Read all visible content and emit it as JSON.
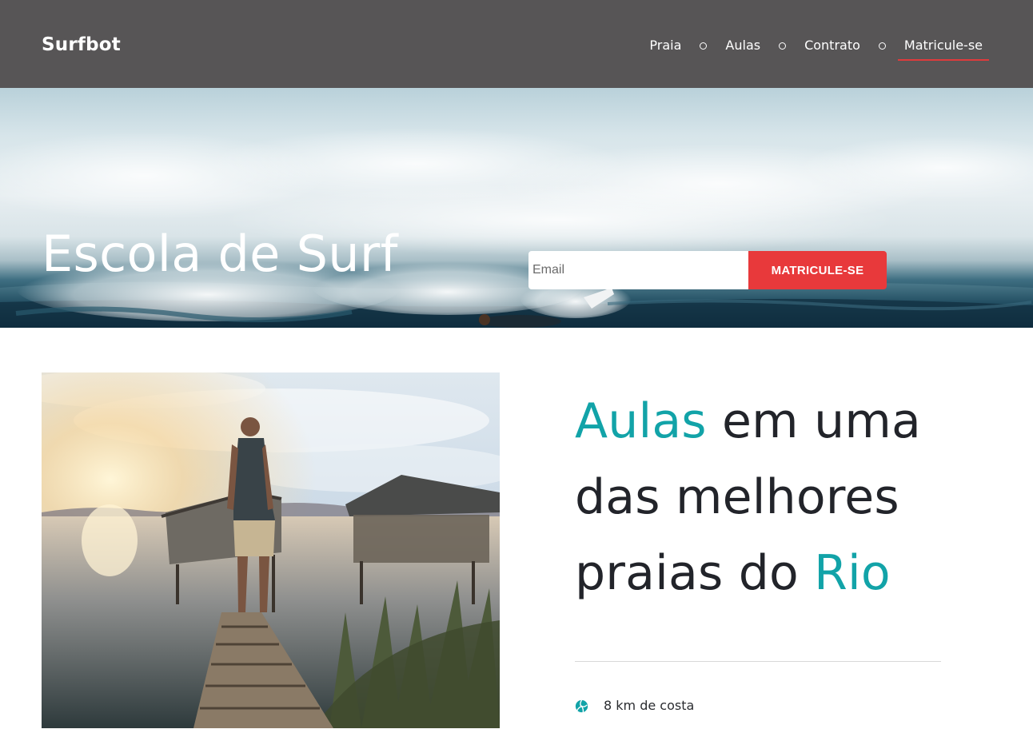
{
  "header": {
    "brand": "Surfbot",
    "nav": [
      {
        "label": "Praia"
      },
      {
        "label": "Aulas"
      },
      {
        "label": "Contrato"
      },
      {
        "label": "Matricule-se",
        "active": true
      }
    ]
  },
  "hero": {
    "title": "Escola de Surf",
    "email_placeholder": "Email",
    "signup_label": "MATRICULE-SE"
  },
  "about": {
    "headline_parts": [
      {
        "text": "Aulas",
        "accent": true
      },
      {
        "text": " em uma das melhores praias do ",
        "accent": false
      },
      {
        "text": "Rio",
        "accent": true
      }
    ],
    "features": [
      {
        "icon": "volleyball-icon",
        "text": "8 km de costa"
      }
    ]
  },
  "colors": {
    "header_bg": "#575556",
    "accent": "#12a3a8",
    "cta": "#e8393b",
    "nav_underline": "#e03a3c"
  }
}
